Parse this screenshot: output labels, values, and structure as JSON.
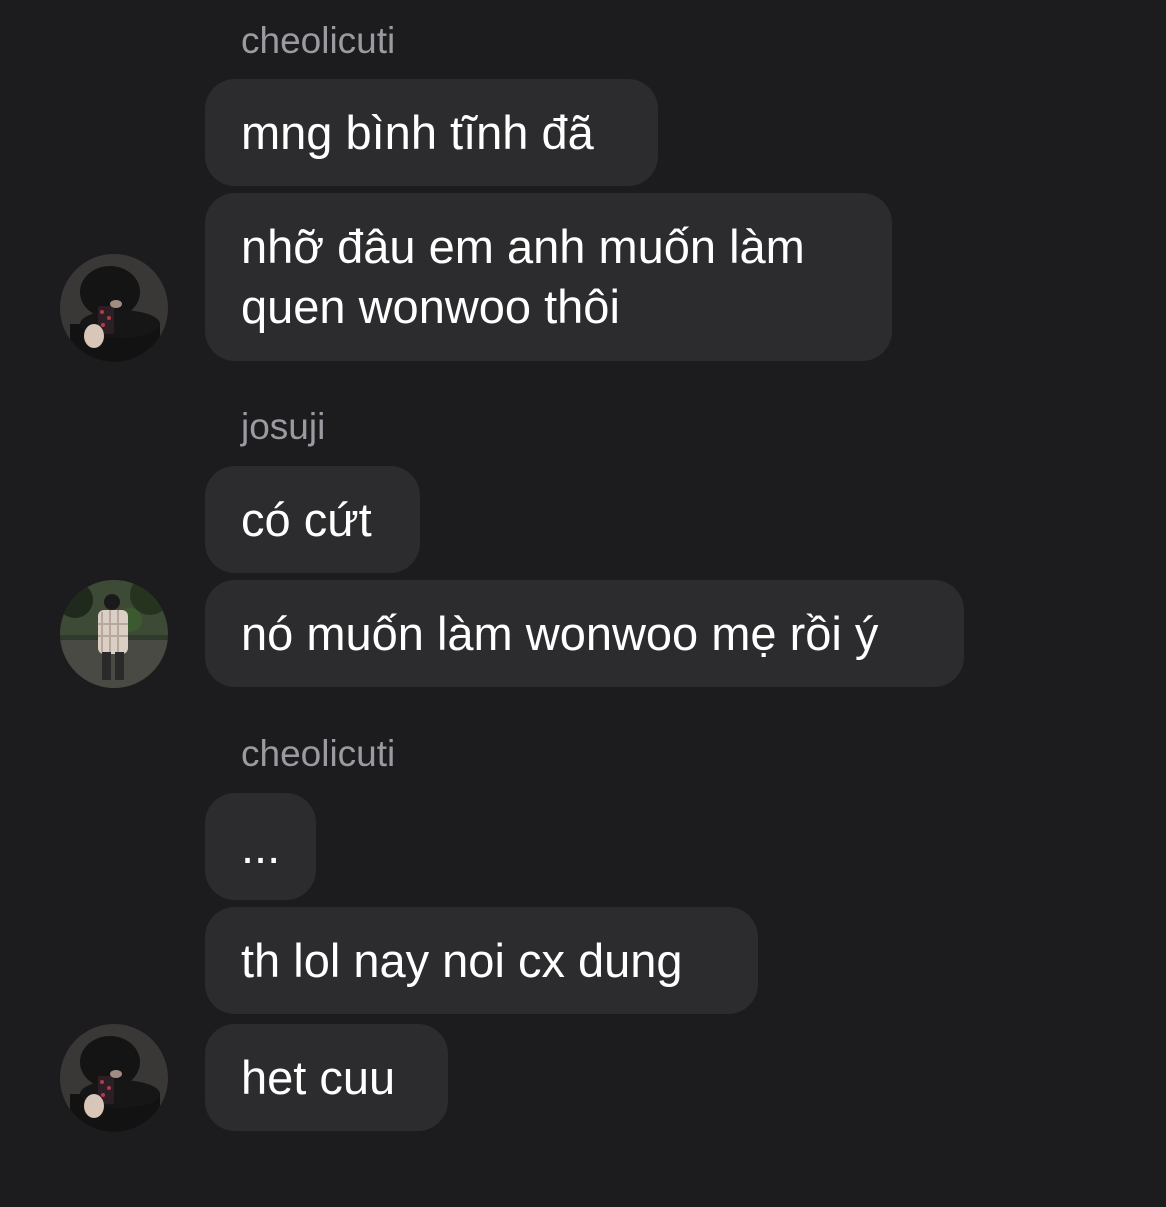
{
  "groups": [
    {
      "sender": "cheolicuti",
      "avatar_icon": "profile-photo-mirror-selfie-icon",
      "messages": [
        "mng bình tĩnh đã",
        "nhỡ đâu em anh muốn làm\nquen wonwoo thôi"
      ]
    },
    {
      "sender": "josuji",
      "avatar_icon": "profile-photo-outdoor-icon",
      "messages": [
        "có cứt",
        "nó muốn làm wonwoo mẹ rồi ý"
      ]
    },
    {
      "sender": "cheolicuti",
      "avatar_icon": "profile-photo-mirror-selfie-icon",
      "messages": [
        "...",
        "th lol nay noi cx dung",
        "het cuu"
      ]
    }
  ],
  "colors": {
    "background": "#1c1c1e",
    "bubble": "#2c2c2e",
    "sender_text": "#9a9aa0",
    "message_text": "#ffffff"
  }
}
